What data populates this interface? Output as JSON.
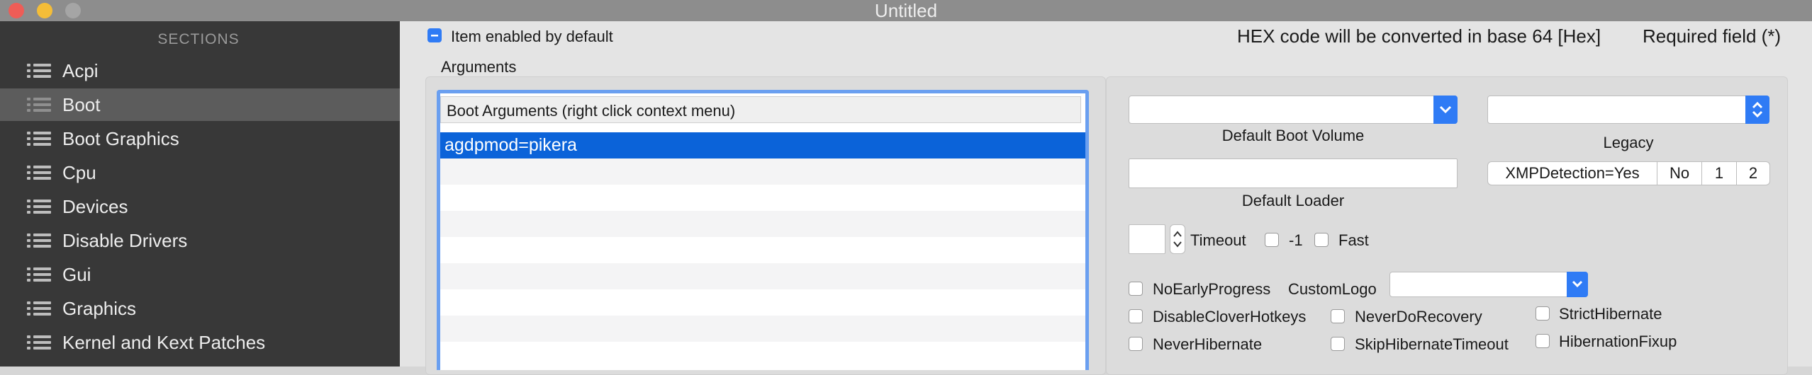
{
  "window": {
    "title": "Untitled"
  },
  "sidebar": {
    "header": "SECTIONS",
    "items": [
      {
        "label": "Acpi"
      },
      {
        "label": "Boot",
        "selected": true
      },
      {
        "label": "Boot Graphics"
      },
      {
        "label": "Cpu"
      },
      {
        "label": "Devices"
      },
      {
        "label": "Disable Drivers"
      },
      {
        "label": "Gui"
      },
      {
        "label": "Graphics"
      },
      {
        "label": "Kernel and Kext Patches"
      }
    ]
  },
  "main": {
    "item_enabled_label": "Item enabled by default",
    "item_enabled_checked": true,
    "hex_note": "HEX code will be converted in base 64 [Hex]",
    "required_note": "Required field (*)",
    "arguments_label": "Arguments",
    "boot_args": {
      "header": "Boot Arguments (right click context menu)",
      "rows": [
        "agdpmod=pikera"
      ]
    },
    "default_boot_volume": {
      "value": "",
      "label": "Default Boot Volume"
    },
    "legacy": {
      "value": "",
      "label": "Legacy"
    },
    "default_loader": {
      "value": "",
      "label": "Default Loader"
    },
    "xmp_segments": [
      "XMPDetection=Yes",
      "No",
      "1",
      "2"
    ],
    "timeout": {
      "value": "",
      "label": "Timeout"
    },
    "minus_one_label": "-1",
    "fast_label": "Fast",
    "no_early_progress_label": "NoEarlyProgress",
    "custom_logo": {
      "label": "CustomLogo",
      "value": ""
    },
    "disable_clover_hotkeys_label": "DisableCloverHotkeys",
    "never_do_recovery_label": "NeverDoRecovery",
    "strict_hibernate_label": "StrictHibernate",
    "never_hibernate_label": "NeverHibernate",
    "skip_hibernate_timeout_label": "SkipHibernateTimeout",
    "hibernation_fixup_label": "HibernationFixup"
  },
  "colors": {
    "accent": "#2f7bf5",
    "selection": "#0b63d9",
    "sidebar_bg": "#383838",
    "sidebar_selected": "#5c5c5c"
  }
}
